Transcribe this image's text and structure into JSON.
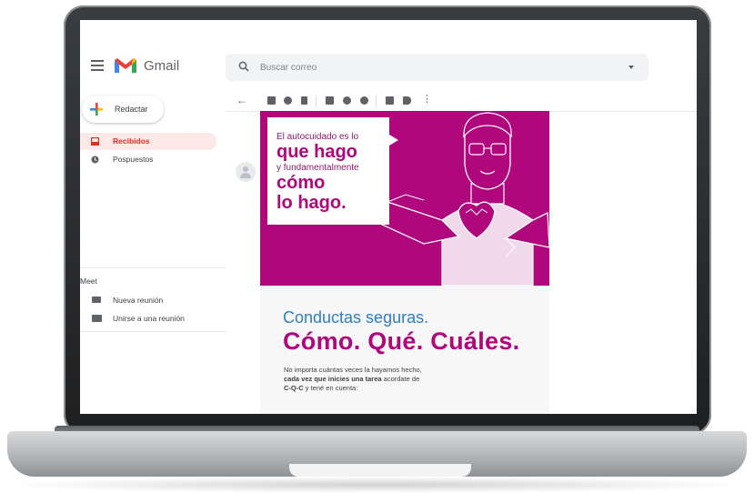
{
  "app": {
    "name": "Gmail"
  },
  "search": {
    "placeholder": "Buscar correo"
  },
  "compose": {
    "label": "Redactar"
  },
  "sidebar": {
    "items": [
      {
        "label": "Recibidos",
        "icon": "inbox-icon",
        "active": true
      },
      {
        "label": "Pospuestos",
        "icon": "clock-icon",
        "active": false
      }
    ],
    "meet": {
      "title": "Meet",
      "items": [
        {
          "label": "Nueva reunión",
          "icon": "video-icon"
        },
        {
          "label": "Unirse a una reunión",
          "icon": "keyboard-icon"
        }
      ]
    }
  },
  "toolbar": {
    "icons": [
      "back-icon",
      "archive-icon",
      "report-spam-icon",
      "delete-icon",
      "mark-unread-icon",
      "snooze-icon",
      "add-task-icon",
      "move-to-icon",
      "label-icon",
      "more-icon"
    ]
  },
  "email": {
    "banner": {
      "line1": "El autocuidado es lo",
      "line2": "que hago",
      "line3": "y fundamentalmente",
      "line4": "cómo",
      "line5": "lo hago."
    },
    "subtitle": "Conductas seguras.",
    "title": "Cómo. Qué. Cuáles.",
    "body_part1": "No importa cuántas veces la hayamos hecho,",
    "body_bold1": "cada vez que inicies una tarea",
    "body_part2": " acordate de",
    "body_bold2": "C-Q-C",
    "body_part3": " y tené en cuenta:"
  },
  "colors": {
    "brand_magenta": "#b0087c",
    "accent_blue": "#2f7cc1",
    "active_nav_bg": "#fce8e6",
    "active_nav_text": "#d93025"
  }
}
